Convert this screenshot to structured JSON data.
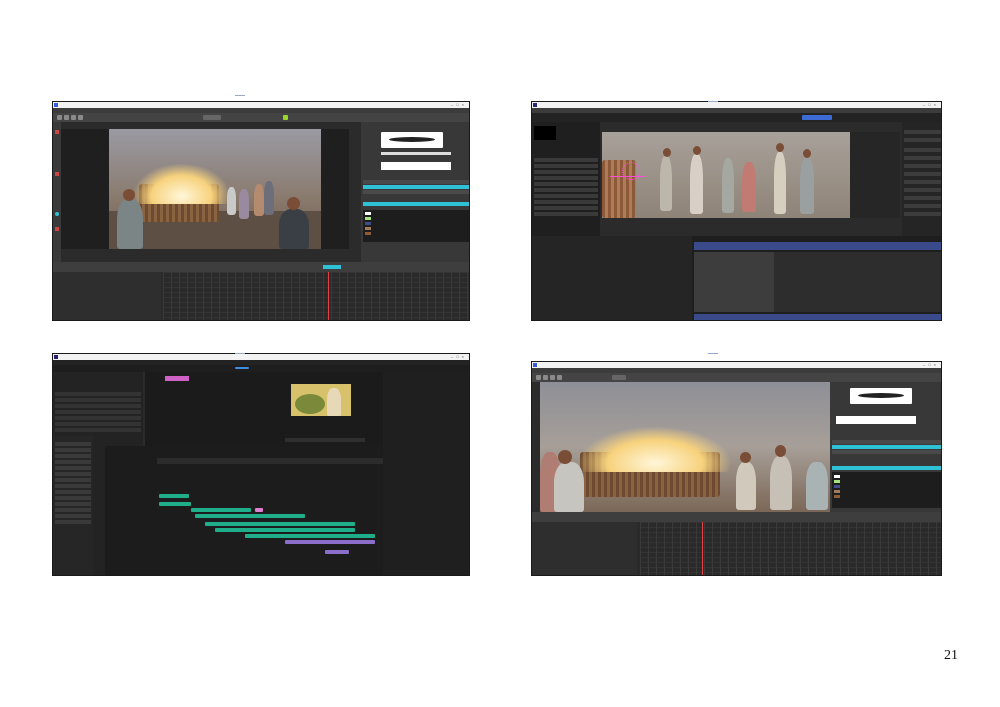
{
  "page": {
    "page_number": "21"
  },
  "screenshots": [
    {
      "name": "toon-boom-harmony-1",
      "app": "Toon Boom Harmony"
    },
    {
      "name": "after-effects",
      "app": "Adobe After Effects"
    },
    {
      "name": "premiere-pro",
      "app": "Adobe Premiere Pro"
    },
    {
      "name": "toon-boom-harmony-2",
      "app": "Toon Boom Harmony"
    }
  ]
}
